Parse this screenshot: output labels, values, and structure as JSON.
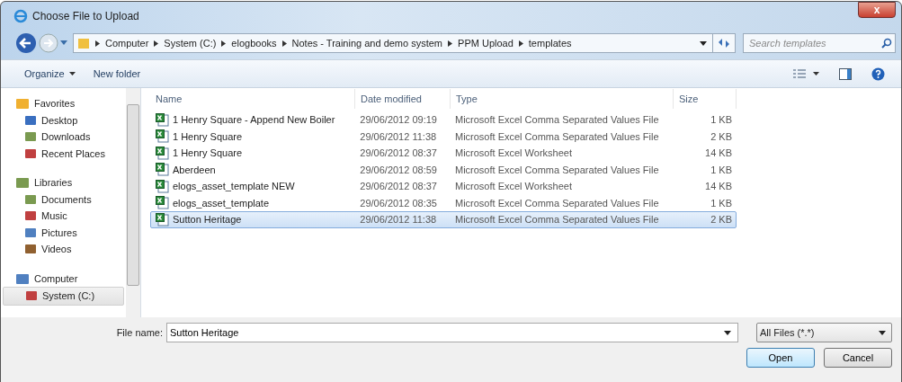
{
  "window": {
    "title": "Choose File to Upload",
    "close": "x"
  },
  "breadcrumb": [
    "Computer",
    "System (C:)",
    "elogbooks",
    "Notes - Training and demo system",
    "PPM Upload",
    "templates"
  ],
  "search": {
    "placeholder": "Search templates"
  },
  "toolbar": {
    "organize": "Organize",
    "new_folder": "New folder"
  },
  "sidebar": [
    {
      "label": "Favorites",
      "children": [
        {
          "label": "Desktop",
          "selected": false
        },
        {
          "label": "Downloads",
          "selected": false
        },
        {
          "label": "Recent Places",
          "selected": false
        }
      ]
    },
    {
      "label": "Libraries",
      "children": [
        {
          "label": "Documents",
          "selected": false
        },
        {
          "label": "Music",
          "selected": false
        },
        {
          "label": "Pictures",
          "selected": false
        },
        {
          "label": "Videos",
          "selected": false
        }
      ]
    },
    {
      "label": "Computer",
      "children": [
        {
          "label": "System (C:)",
          "selected": true
        }
      ]
    }
  ],
  "table": {
    "columns": [
      "Name",
      "Date modified",
      "Type",
      "Size"
    ],
    "rows": [
      {
        "name": "1 Henry Square - Append New Boiler",
        "date": "29/06/2012 09:19",
        "type": "Microsoft Excel Comma Separated Values File",
        "size": "1 KB",
        "selected": false
      },
      {
        "name": "1 Henry Square",
        "date": "29/06/2012 11:38",
        "type": "Microsoft Excel Comma Separated Values File",
        "size": "2 KB",
        "selected": false
      },
      {
        "name": "1 Henry Square",
        "date": "29/06/2012 08:37",
        "type": "Microsoft Excel Worksheet",
        "size": "14 KB",
        "selected": false
      },
      {
        "name": "Aberdeen",
        "date": "29/06/2012 08:59",
        "type": "Microsoft Excel Comma Separated Values File",
        "size": "1 KB",
        "selected": false
      },
      {
        "name": "elogs_asset_template NEW",
        "date": "29/06/2012 08:37",
        "type": "Microsoft Excel Worksheet",
        "size": "14 KB",
        "selected": false
      },
      {
        "name": "elogs_asset_template",
        "date": "29/06/2012 08:35",
        "type": "Microsoft Excel Comma Separated Values File",
        "size": "1 KB",
        "selected": false
      },
      {
        "name": "Sutton Heritage",
        "date": "29/06/2012 11:38",
        "type": "Microsoft Excel Comma Separated Values File",
        "size": "2 KB",
        "selected": true
      }
    ]
  },
  "footer": {
    "file_name_label": "File name:",
    "file_name": "Sutton Heritage",
    "filter": "All Files (*.*)",
    "open": "Open",
    "cancel": "Cancel"
  }
}
